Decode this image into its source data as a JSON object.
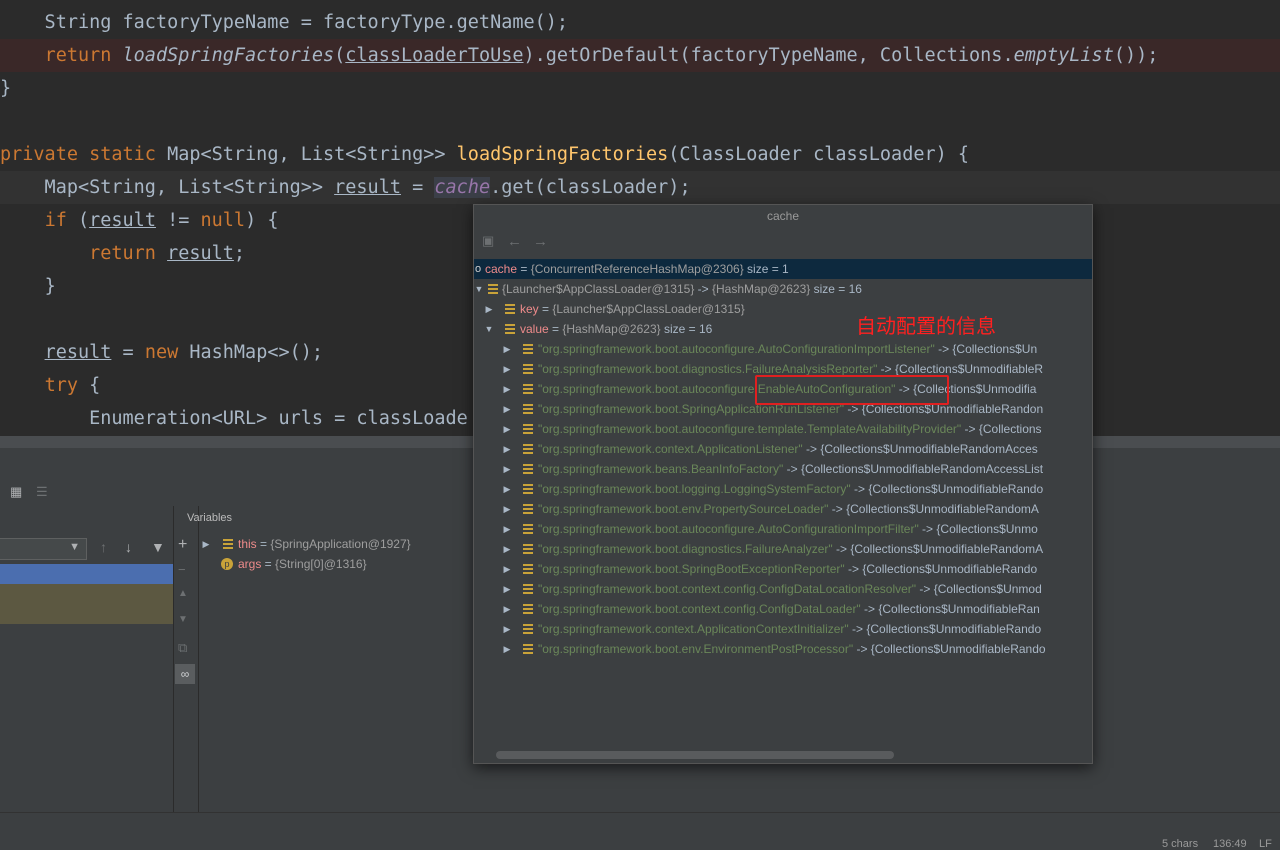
{
  "editor": {
    "line1": {
      "a": "    String factoryTypeName = factoryType.getName();"
    },
    "line2": {
      "kw": "return",
      "fn": "loadSpringFactories",
      "arg": "classLoaderToUse",
      "rest": ").getOrDefault(factoryTypeName, Collections.",
      "fn2": "emptyList",
      "end": "());"
    },
    "line3": "}",
    "line5": {
      "kw1": "private",
      "kw2": "static",
      "type": " Map<String, List<String>> ",
      "fn": "loadSpringFactories",
      "rest": "(ClassLoader classLoader) {"
    },
    "line6": {
      "a": "    Map<String, List<String>> ",
      "b": "result",
      "c": " = ",
      "d": "cache",
      "e": ".get(classLoader);"
    },
    "line7": {
      "kw": "if",
      "a": " (",
      "b": "result",
      "c": " != ",
      "d": "null",
      "e": ") {"
    },
    "line8": {
      "kw": "return",
      "b": "result",
      "c": ";"
    },
    "line9": "}",
    "line11": {
      "a": "result",
      "b": " = ",
      "kw": "new",
      "c": " HashMap<>();"
    },
    "line12": {
      "kw": "try",
      "c": " {"
    },
    "line13": "        Enumeration<URL> urls = classLoade"
  },
  "debug": {
    "variables_title": "Variables",
    "vars": [
      {
        "name": "this",
        "eq": " = ",
        "val": "{SpringApplication@1927}"
      },
      {
        "name": "args",
        "eq": " = ",
        "val": "{String[0]@1316}"
      }
    ],
    "status": {
      "chars": "5 chars",
      "pos": "136:49",
      "le": "LF"
    }
  },
  "popup": {
    "title": "cache",
    "root": {
      "name": "cache",
      "eq": " = ",
      "val": "{ConcurrentReferenceHashMap@2306}",
      "size": "  size = 1"
    },
    "entry": {
      "val": "{Launcher$AppClassLoader@1315}",
      "arrow": "  -> ",
      "val2": "{HashMap@2623}",
      "size": "  size = 16"
    },
    "key": {
      "name": "key",
      "eq": " = ",
      "val": "{Launcher$AppClassLoader@1315}"
    },
    "value": {
      "name": "value",
      "eq": " = ",
      "val": "{HashMap@2623}",
      "size": "  size = 16"
    },
    "items": [
      {
        "k": "\"org.springframework.boot.autoconfigure.AutoConfigurationImportListener\"",
        "v": " -> {Collections$Un"
      },
      {
        "k": "\"org.springframework.boot.diagnostics.FailureAnalysisReporter\"",
        "v": " -> {Collections$UnmodifiableR"
      },
      {
        "k": "\"org.springframework.boot.autoconfigure.EnableAutoConfiguration\"",
        "v": " -> {Collections$Unmodifia"
      },
      {
        "k": "\"org.springframework.boot.SpringApplicationRunListener\"",
        "v": " -> {Collections$UnmodifiableRandon"
      },
      {
        "k": "\"org.springframework.boot.autoconfigure.template.TemplateAvailabilityProvider\"",
        "v": " -> {Collections"
      },
      {
        "k": "\"org.springframework.context.ApplicationListener\"",
        "v": " -> {Collections$UnmodifiableRandomAcces"
      },
      {
        "k": "\"org.springframework.beans.BeanInfoFactory\"",
        "v": " -> {Collections$UnmodifiableRandomAccessList"
      },
      {
        "k": "\"org.springframework.boot.logging.LoggingSystemFactory\"",
        "v": " -> {Collections$UnmodifiableRando"
      },
      {
        "k": "\"org.springframework.boot.env.PropertySourceLoader\"",
        "v": " -> {Collections$UnmodifiableRandomA"
      },
      {
        "k": "\"org.springframework.boot.autoconfigure.AutoConfigurationImportFilter\"",
        "v": " -> {Collections$Unmo"
      },
      {
        "k": "\"org.springframework.boot.diagnostics.FailureAnalyzer\"",
        "v": " -> {Collections$UnmodifiableRandomA"
      },
      {
        "k": "\"org.springframework.boot.SpringBootExceptionReporter\"",
        "v": " -> {Collections$UnmodifiableRando"
      },
      {
        "k": "\"org.springframework.boot.context.config.ConfigDataLocationResolver\"",
        "v": " -> {Collections$Unmod"
      },
      {
        "k": "\"org.springframework.boot.context.config.ConfigDataLoader\"",
        "v": " -> {Collections$UnmodifiableRan"
      },
      {
        "k": "\"org.springframework.context.ApplicationContextInitializer\"",
        "v": " -> {Collections$UnmodifiableRando"
      },
      {
        "k": "\"org.springframework.boot.env.EnvironmentPostProcessor\"",
        "v": " -> {Collections$UnmodifiableRando"
      }
    ]
  },
  "annotation": {
    "text": "自动配置的信息"
  }
}
